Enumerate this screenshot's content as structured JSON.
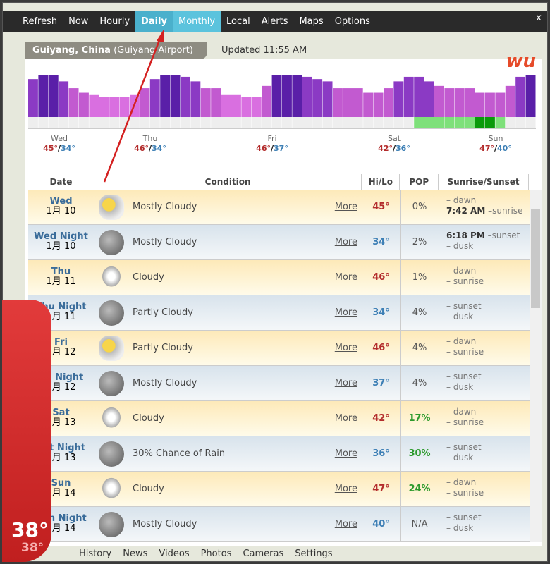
{
  "nav": {
    "items": [
      "Refresh",
      "Now",
      "Hourly",
      "Daily",
      "Monthly",
      "Local",
      "Alerts",
      "Maps",
      "Options"
    ],
    "active": "Monthly",
    "close": "x"
  },
  "location": {
    "city": "Guiyang, China",
    "station": "(Guiyang Airport)",
    "updated": "Updated 11:55 AM"
  },
  "logo": "wu",
  "chart_data": {
    "type": "bar",
    "hourly_temp": [
      42,
      45,
      46,
      41,
      38,
      36,
      35,
      34,
      34,
      34,
      35,
      38,
      42,
      45,
      47,
      43,
      41,
      38,
      38,
      35,
      35,
      34,
      34,
      39,
      45,
      46,
      46,
      43,
      42,
      41,
      38,
      38,
      38,
      36,
      36,
      38,
      41,
      43,
      43,
      41,
      39,
      38,
      38,
      38,
      36,
      36,
      36,
      39,
      43,
      45
    ],
    "hourly_pop_level": [
      0,
      0,
      0,
      0,
      0,
      0,
      0,
      0,
      0,
      0,
      0,
      0,
      0,
      0,
      0,
      0,
      0,
      0,
      0,
      0,
      0,
      0,
      0,
      0,
      0,
      0,
      0,
      0,
      0,
      0,
      0,
      0,
      0,
      0,
      0,
      0,
      0,
      0,
      1,
      1,
      1,
      1,
      1,
      1,
      2,
      2,
      1,
      0,
      0,
      0
    ],
    "days": [
      {
        "name": "Wed",
        "hi": "45°",
        "lo": "34°"
      },
      {
        "name": "Thu",
        "hi": "46°",
        "lo": "34°"
      },
      {
        "name": "Fri",
        "hi": "46°",
        "lo": "37°"
      },
      {
        "name": "Sat",
        "hi": "42°",
        "lo": "36°"
      },
      {
        "name": "Sun",
        "hi": "47°",
        "lo": "40°"
      }
    ],
    "colors": {
      "dark": "#5a1fa8",
      "mid": "#8b3ac4",
      "light": "#c25ad0",
      "lightest": "#d96fe0",
      "pop_light": "#7ee07a",
      "pop_dark": "#0a9a0a"
    }
  },
  "table": {
    "headers": [
      "Date",
      "Condition",
      "Hi/Lo",
      "POP",
      "Sunrise/Sunset"
    ],
    "rows": [
      {
        "day": "Wed",
        "date": "1月 10",
        "icon": "sun-cloud",
        "cond": "Mostly Cloudy",
        "more": "More",
        "temp": "45°",
        "pop": "0%",
        "s1": "– dawn",
        "s2t": "7:42 AM",
        "s2": " –sunrise",
        "night": false,
        "green": false
      },
      {
        "day": "Wed Night",
        "date": "1月 10",
        "icon": "moon-cloud",
        "cond": "Mostly Cloudy",
        "more": "More",
        "temp": "34°",
        "pop": "2%",
        "s1t": "6:18 PM",
        "s1": " –sunset",
        "s2": "– dusk",
        "night": true,
        "green": false
      },
      {
        "day": "Thu",
        "date": "1月 11",
        "icon": "cloud",
        "cond": "Cloudy",
        "more": "More",
        "temp": "46°",
        "pop": "1%",
        "s1": "– dawn",
        "s2": "– sunrise",
        "night": false,
        "green": false
      },
      {
        "day": "Thu Night",
        "date": "1月 11",
        "icon": "moon",
        "cond": "Partly Cloudy",
        "more": "More",
        "temp": "34°",
        "pop": "4%",
        "s1": "– sunset",
        "s2": "– dusk",
        "night": true,
        "green": false
      },
      {
        "day": "Fri",
        "date": "1月 12",
        "icon": "sun-cloud",
        "cond": "Partly Cloudy",
        "more": "More",
        "temp": "46°",
        "pop": "4%",
        "s1": "– dawn",
        "s2": "– sunrise",
        "night": false,
        "green": false
      },
      {
        "day": "Fri Night",
        "date": "1月 12",
        "icon": "moon-cloud",
        "cond": "Mostly Cloudy",
        "more": "More",
        "temp": "37°",
        "pop": "4%",
        "s1": "– sunset",
        "s2": "– dusk",
        "night": true,
        "green": false
      },
      {
        "day": "Sat",
        "date": "1月 13",
        "icon": "cloud",
        "cond": "Cloudy",
        "more": "More",
        "temp": "42°",
        "pop": "17%",
        "s1": "– dawn",
        "s2": "– sunrise",
        "night": false,
        "green": true
      },
      {
        "day": "Sat Night",
        "date": "1月 13",
        "icon": "moon-rain",
        "cond": "30% Chance of Rain",
        "more": "More",
        "temp": "36°",
        "pop": "30%",
        "s1": "– sunset",
        "s2": "– dusk",
        "night": true,
        "green": true
      },
      {
        "day": "Sun",
        "date": "1月 14",
        "icon": "cloud",
        "cond": "Cloudy",
        "more": "More",
        "temp": "47°",
        "pop": "24%",
        "s1": "– dawn",
        "s2": "– sunrise",
        "night": false,
        "green": true
      },
      {
        "day": "Sun Night",
        "date": "1月 14",
        "icon": "moon-cloud",
        "cond": "Mostly Cloudy",
        "more": "More",
        "temp": "40°",
        "pop": "N/A",
        "s1": "– sunset",
        "s2": "– dusk",
        "night": true,
        "green": false
      }
    ]
  },
  "footer": [
    "History",
    "News",
    "Videos",
    "Photos",
    "Cameras",
    "Settings"
  ],
  "current": {
    "temp": "38°",
    "feels": "38°"
  }
}
